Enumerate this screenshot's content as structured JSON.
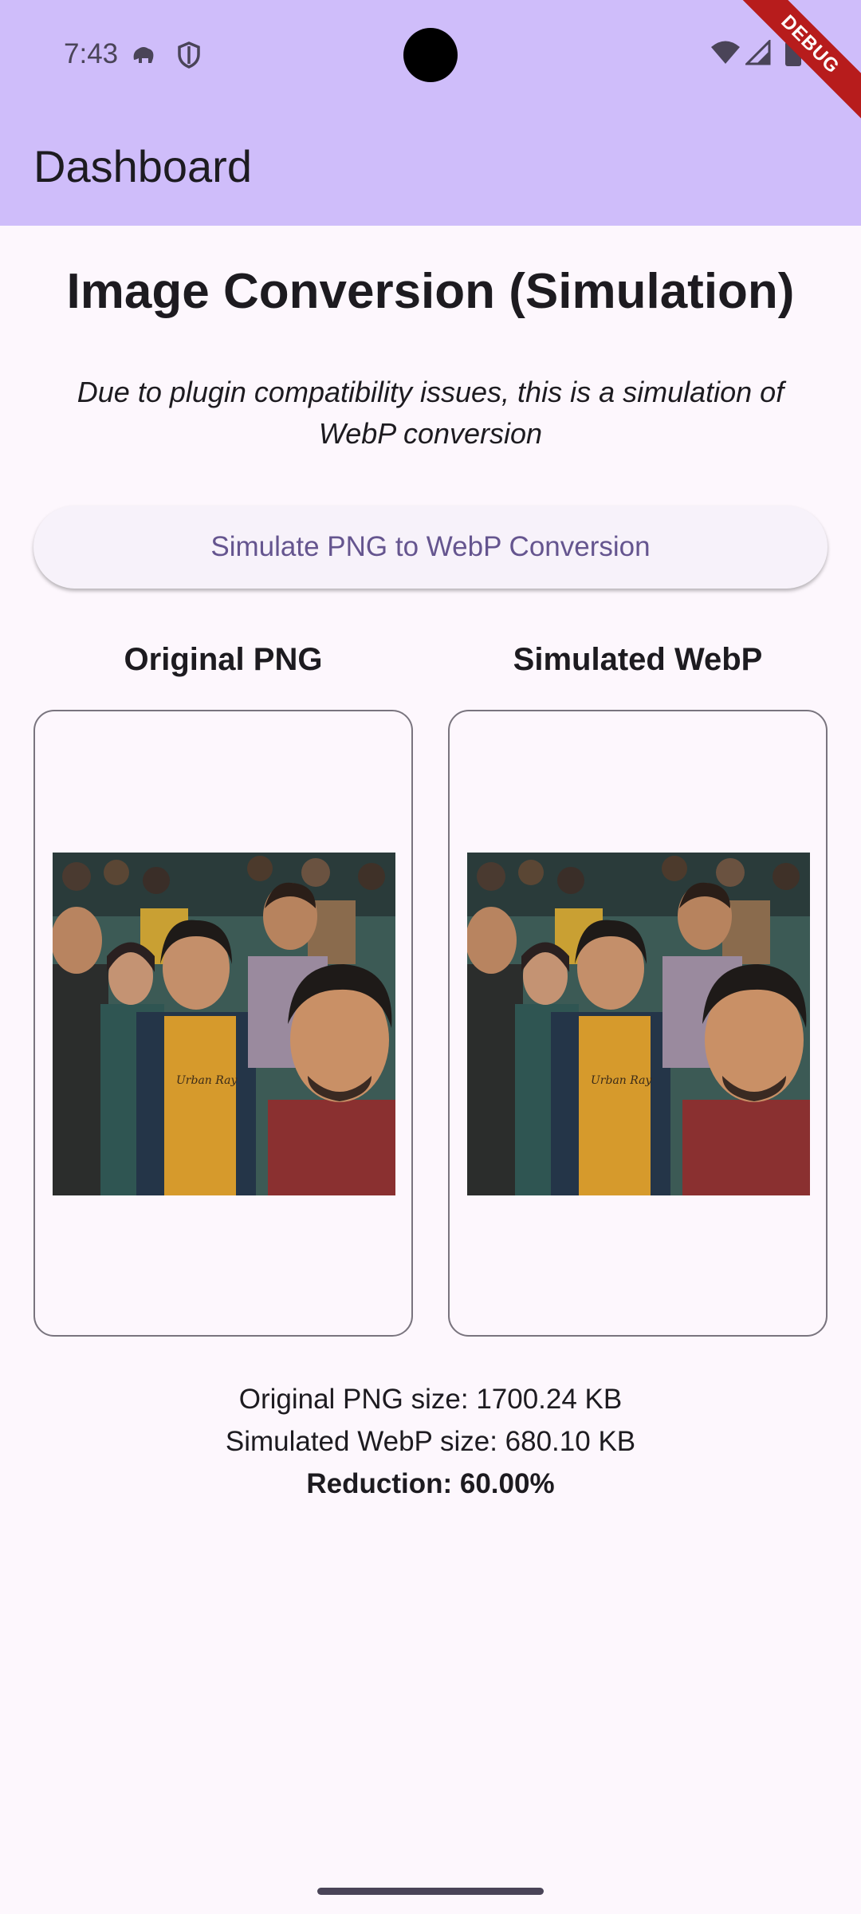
{
  "status_bar": {
    "time": "7:43"
  },
  "debug_banner": "DEBUG",
  "app_bar": {
    "title": "Dashboard"
  },
  "main": {
    "heading": "Image Conversion (Simulation)",
    "subtitle": "Due to plugin compatibility issues, this is a simulation of WebP conversion",
    "convert_button_label": "Simulate PNG to WebP Conversion",
    "original_label": "Original PNG",
    "webp_label": "Simulated WebP",
    "image_shirt_text": "Urban Ray",
    "original_size": "Original PNG size: 1700.24 KB",
    "webp_size": "Simulated WebP size: 680.10 KB",
    "reduction": "Reduction: 60.00%"
  },
  "colors": {
    "app_bar": "#cfbdfa",
    "background": "#fdf7fd",
    "button_text": "#65558f",
    "debug_ribbon": "#b71c1c"
  }
}
